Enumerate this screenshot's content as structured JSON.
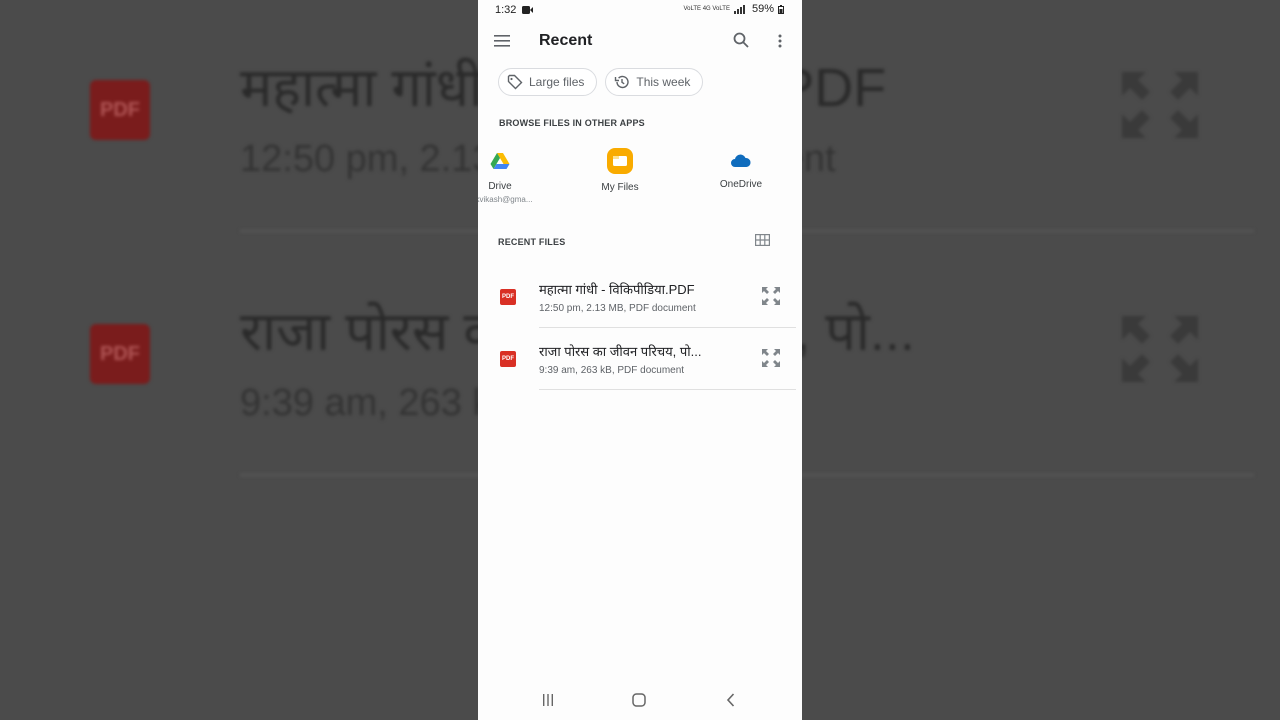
{
  "background": {
    "row1_title": "महात्मा गांधी - विकिपीडिया.PDF",
    "row1_meta": "12:50 pm, 2.13 MB, PDF document",
    "row2_title": "राजा पोरस का जीवन परिचय, पो...",
    "row2_meta": "9:39 am, 263 kB, PDF document",
    "pdf_badge": "PDF"
  },
  "status_bar": {
    "time": "1:32",
    "network": "VoLTE 4G VoLTE",
    "battery": "59%"
  },
  "app_bar": {
    "title": "Recent",
    "menu_icon": "menu-icon",
    "search_icon": "search-icon",
    "more_icon": "more-vert-icon"
  },
  "chips": [
    {
      "label": "Large files",
      "icon": "tag-icon"
    },
    {
      "label": "This week",
      "icon": "history-icon"
    }
  ],
  "browse_section": {
    "title": "BROWSE FILES IN OTHER APPS",
    "apps": [
      {
        "label": "Drive",
        "account": "kvkvikash@gma...",
        "icon": "google-drive-icon"
      },
      {
        "label": "My Files",
        "icon": "my-files-icon"
      },
      {
        "label": "OneDrive",
        "icon": "onedrive-icon"
      }
    ]
  },
  "recent_section": {
    "title": "RECENT FILES",
    "grid_icon": "grid-view-icon",
    "files": [
      {
        "name": "महात्मा गांधी - विकिपीडिया.PDF",
        "meta": "12:50 pm, 2.13 MB, PDF document",
        "badge": "PDF"
      },
      {
        "name": "राजा पोरस का जीवन परिचय, पो...",
        "meta": "9:39 am, 263 kB, PDF document",
        "badge": "PDF"
      }
    ]
  },
  "colors": {
    "pdf_red": "#d93025",
    "drive_blue": "#4285f4",
    "myfiles_orange": "#f9ab00",
    "onedrive_blue": "#0f6cbd"
  }
}
